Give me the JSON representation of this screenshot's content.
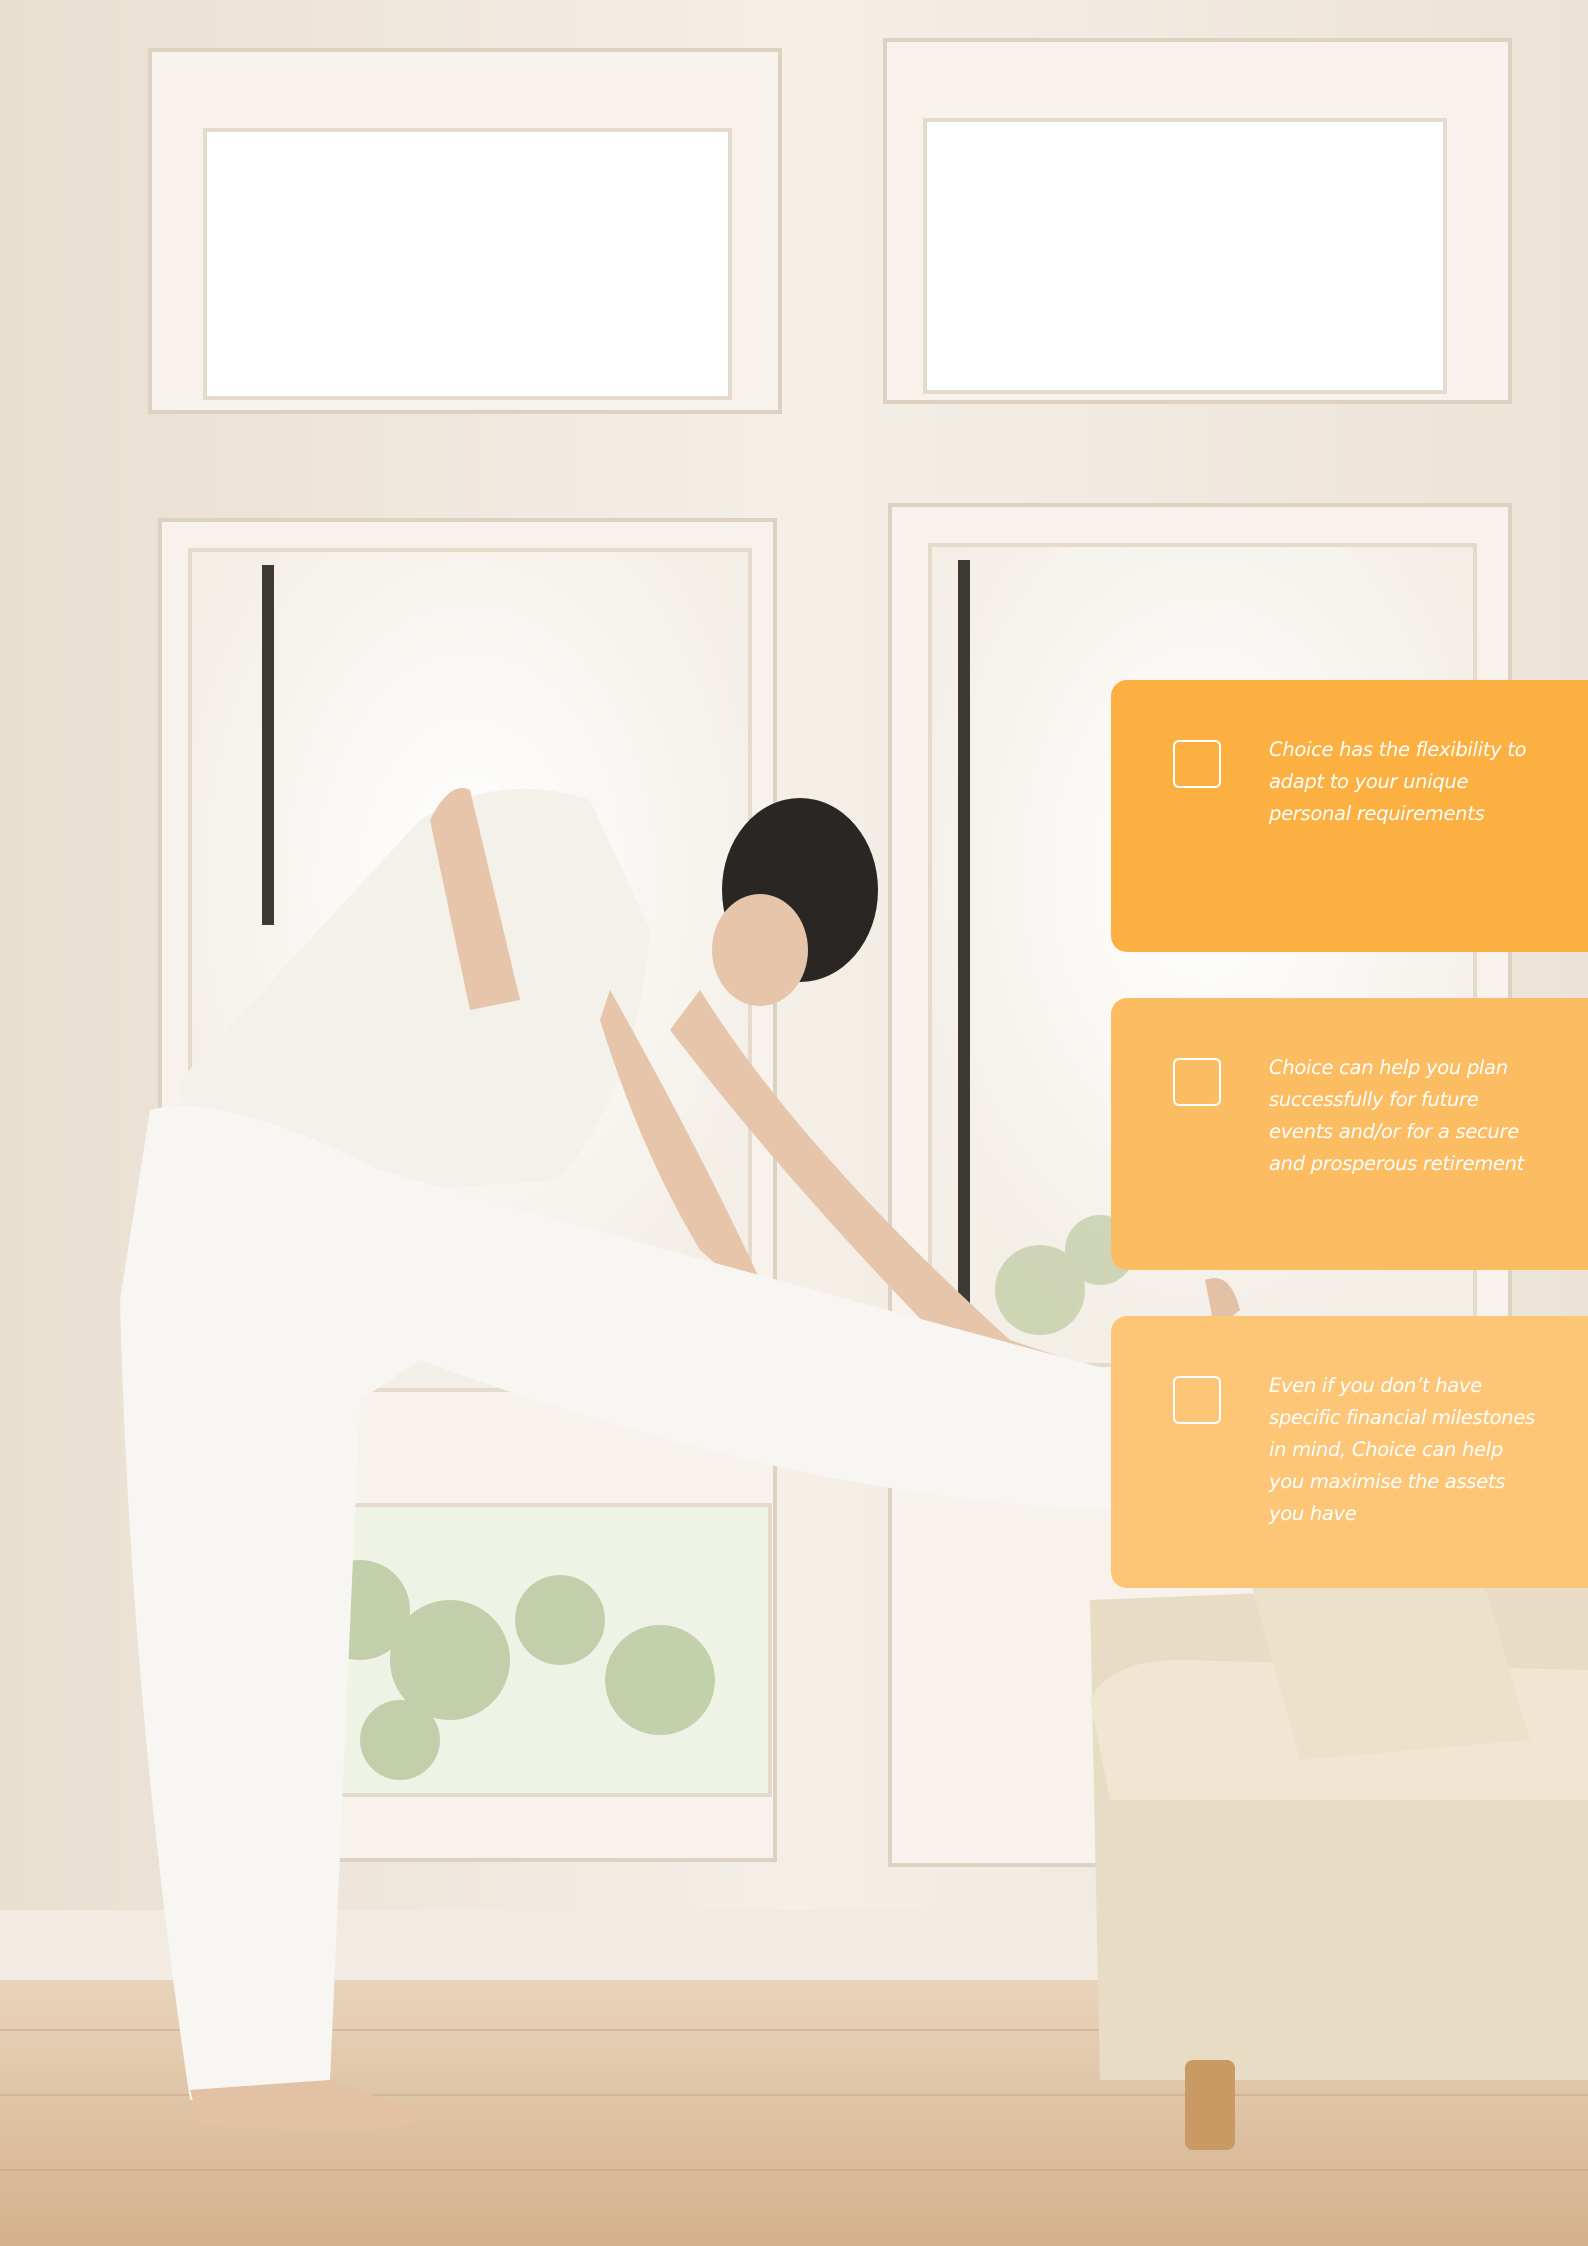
{
  "colors": {
    "box_1": "#fbb041",
    "box_2": "#fcbc62",
    "box_3": "#fdc677",
    "text": "#ffffff"
  },
  "photo": {
    "subject": "woman-stretching-by-window-photo"
  },
  "boxes": [
    {
      "text": "Choice has the flexibility to adapt to your unique personal requirements"
    },
    {
      "text": "Choice can help you plan successfully for future events and/or for a secure and prosperous retirement"
    },
    {
      "text": "Even if you don’t have specific financial milestones in mind, Choice can help you maximise the assets you have"
    }
  ]
}
